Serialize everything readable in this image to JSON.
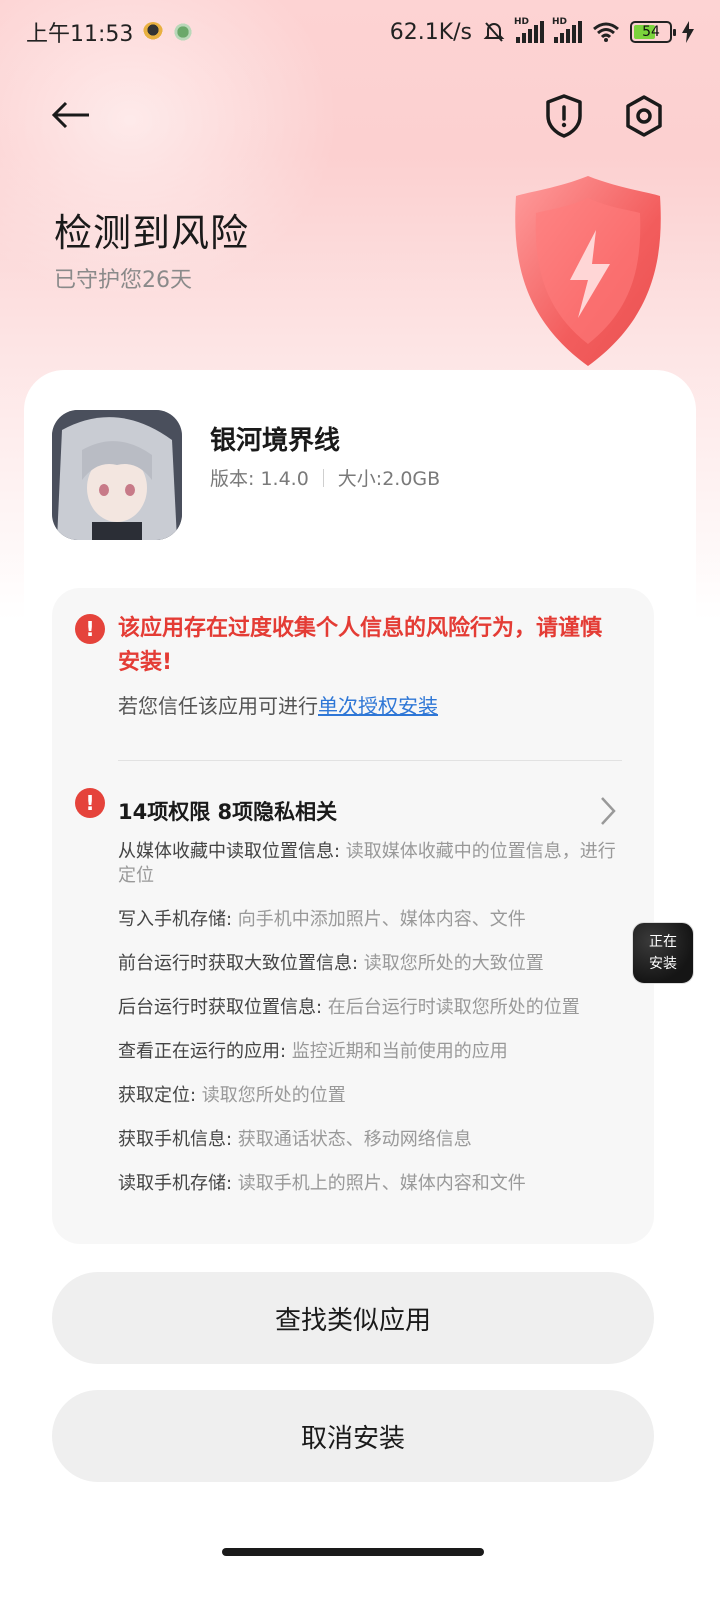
{
  "status_bar": {
    "time": "上午11:53",
    "network_speed": "62.1K/s",
    "battery_level": "54",
    "icons": [
      "notification-app-icon",
      "notification-app-icon",
      "mute-bell-icon",
      "signal-hd-icon",
      "signal-hd-icon",
      "wifi-icon",
      "battery-icon",
      "charging-icon"
    ]
  },
  "header": {
    "title": "检测到风险",
    "subtitle": "已守护您26天"
  },
  "app": {
    "name": "银河境界线",
    "version": "版本: 1.4.0",
    "size": "大小:2.0GB"
  },
  "warning": {
    "message": "该应用存在过度收集个人信息的风险行为，请谨慎安装!",
    "trust_prefix": "若您信任该应用可进行",
    "trust_link": "单次授权安装"
  },
  "permissions": {
    "summary": "14项权限 8项隐私相关",
    "items": [
      {
        "name": "从媒体收藏中读取位置信息: ",
        "desc": "读取媒体收藏中的位置信息，进行定位"
      },
      {
        "name": "写入手机存储: ",
        "desc": "向手机中添加照片、媒体内容、文件"
      },
      {
        "name": "前台运行时获取大致位置信息: ",
        "desc": "读取您所处的大致位置"
      },
      {
        "name": "后台运行时获取位置信息: ",
        "desc": "在后台运行时读取您所处的位置"
      },
      {
        "name": "查看正在运行的应用: ",
        "desc": "监控近期和当前使用的应用"
      },
      {
        "name": "获取定位: ",
        "desc": "读取您所处的位置"
      },
      {
        "name": "获取手机信息: ",
        "desc": "获取通话状态、移动网络信息"
      },
      {
        "name": "读取手机存储: ",
        "desc": "读取手机上的照片、媒体内容和文件"
      }
    ]
  },
  "floating": {
    "line1": "正在",
    "line2": "安装"
  },
  "buttons": {
    "find_similar": "查找类似应用",
    "cancel_install": "取消安装"
  },
  "colors": {
    "warning_red": "#e43c35",
    "link_blue": "#2f77d6",
    "header_bg": "#fcd0d0"
  }
}
